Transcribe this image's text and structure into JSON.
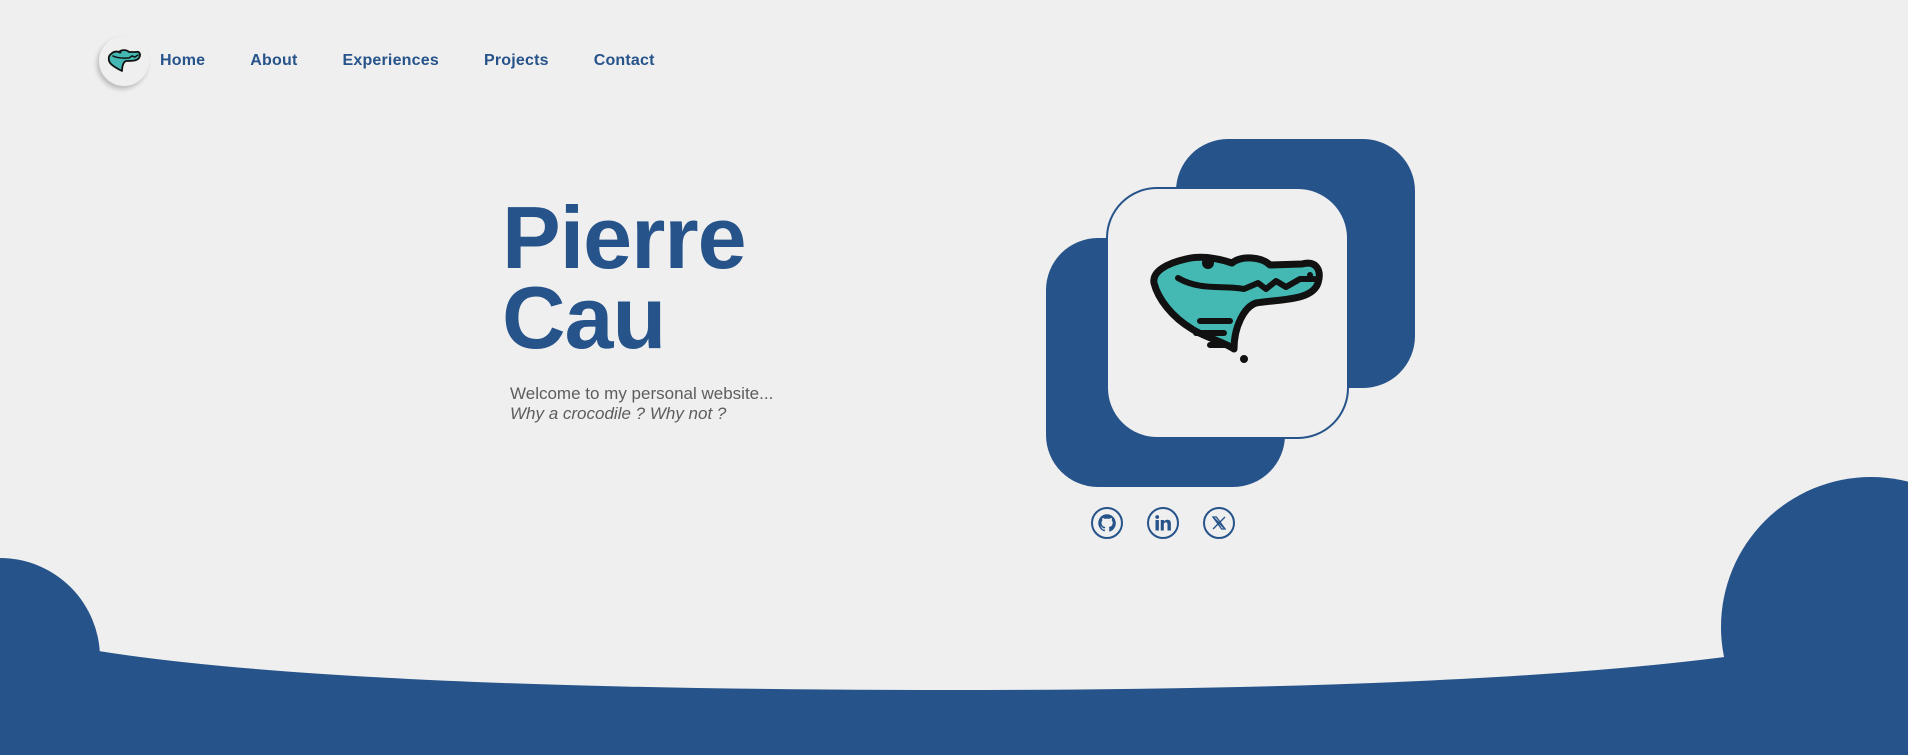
{
  "colors": {
    "background": "#efefef",
    "primary": "#26538a",
    "croc_teal": "#44b9b3",
    "text_muted": "#5d5d5d"
  },
  "nav": {
    "logo_icon": "crocodile-logo-icon",
    "items": [
      {
        "label": "Home"
      },
      {
        "label": "About"
      },
      {
        "label": "Experiences"
      },
      {
        "label": "Projects"
      },
      {
        "label": "Contact"
      }
    ]
  },
  "hero": {
    "first_name": "Pierre",
    "last_name": "Cau",
    "welcome": "Welcome to my personal website...",
    "tagline": "Why a crocodile ? Why not ?"
  },
  "profile": {
    "image_icon": "crocodile-head-icon"
  },
  "socials": [
    {
      "icon": "github-icon"
    },
    {
      "icon": "linkedin-icon"
    },
    {
      "icon": "x-twitter-icon"
    }
  ]
}
